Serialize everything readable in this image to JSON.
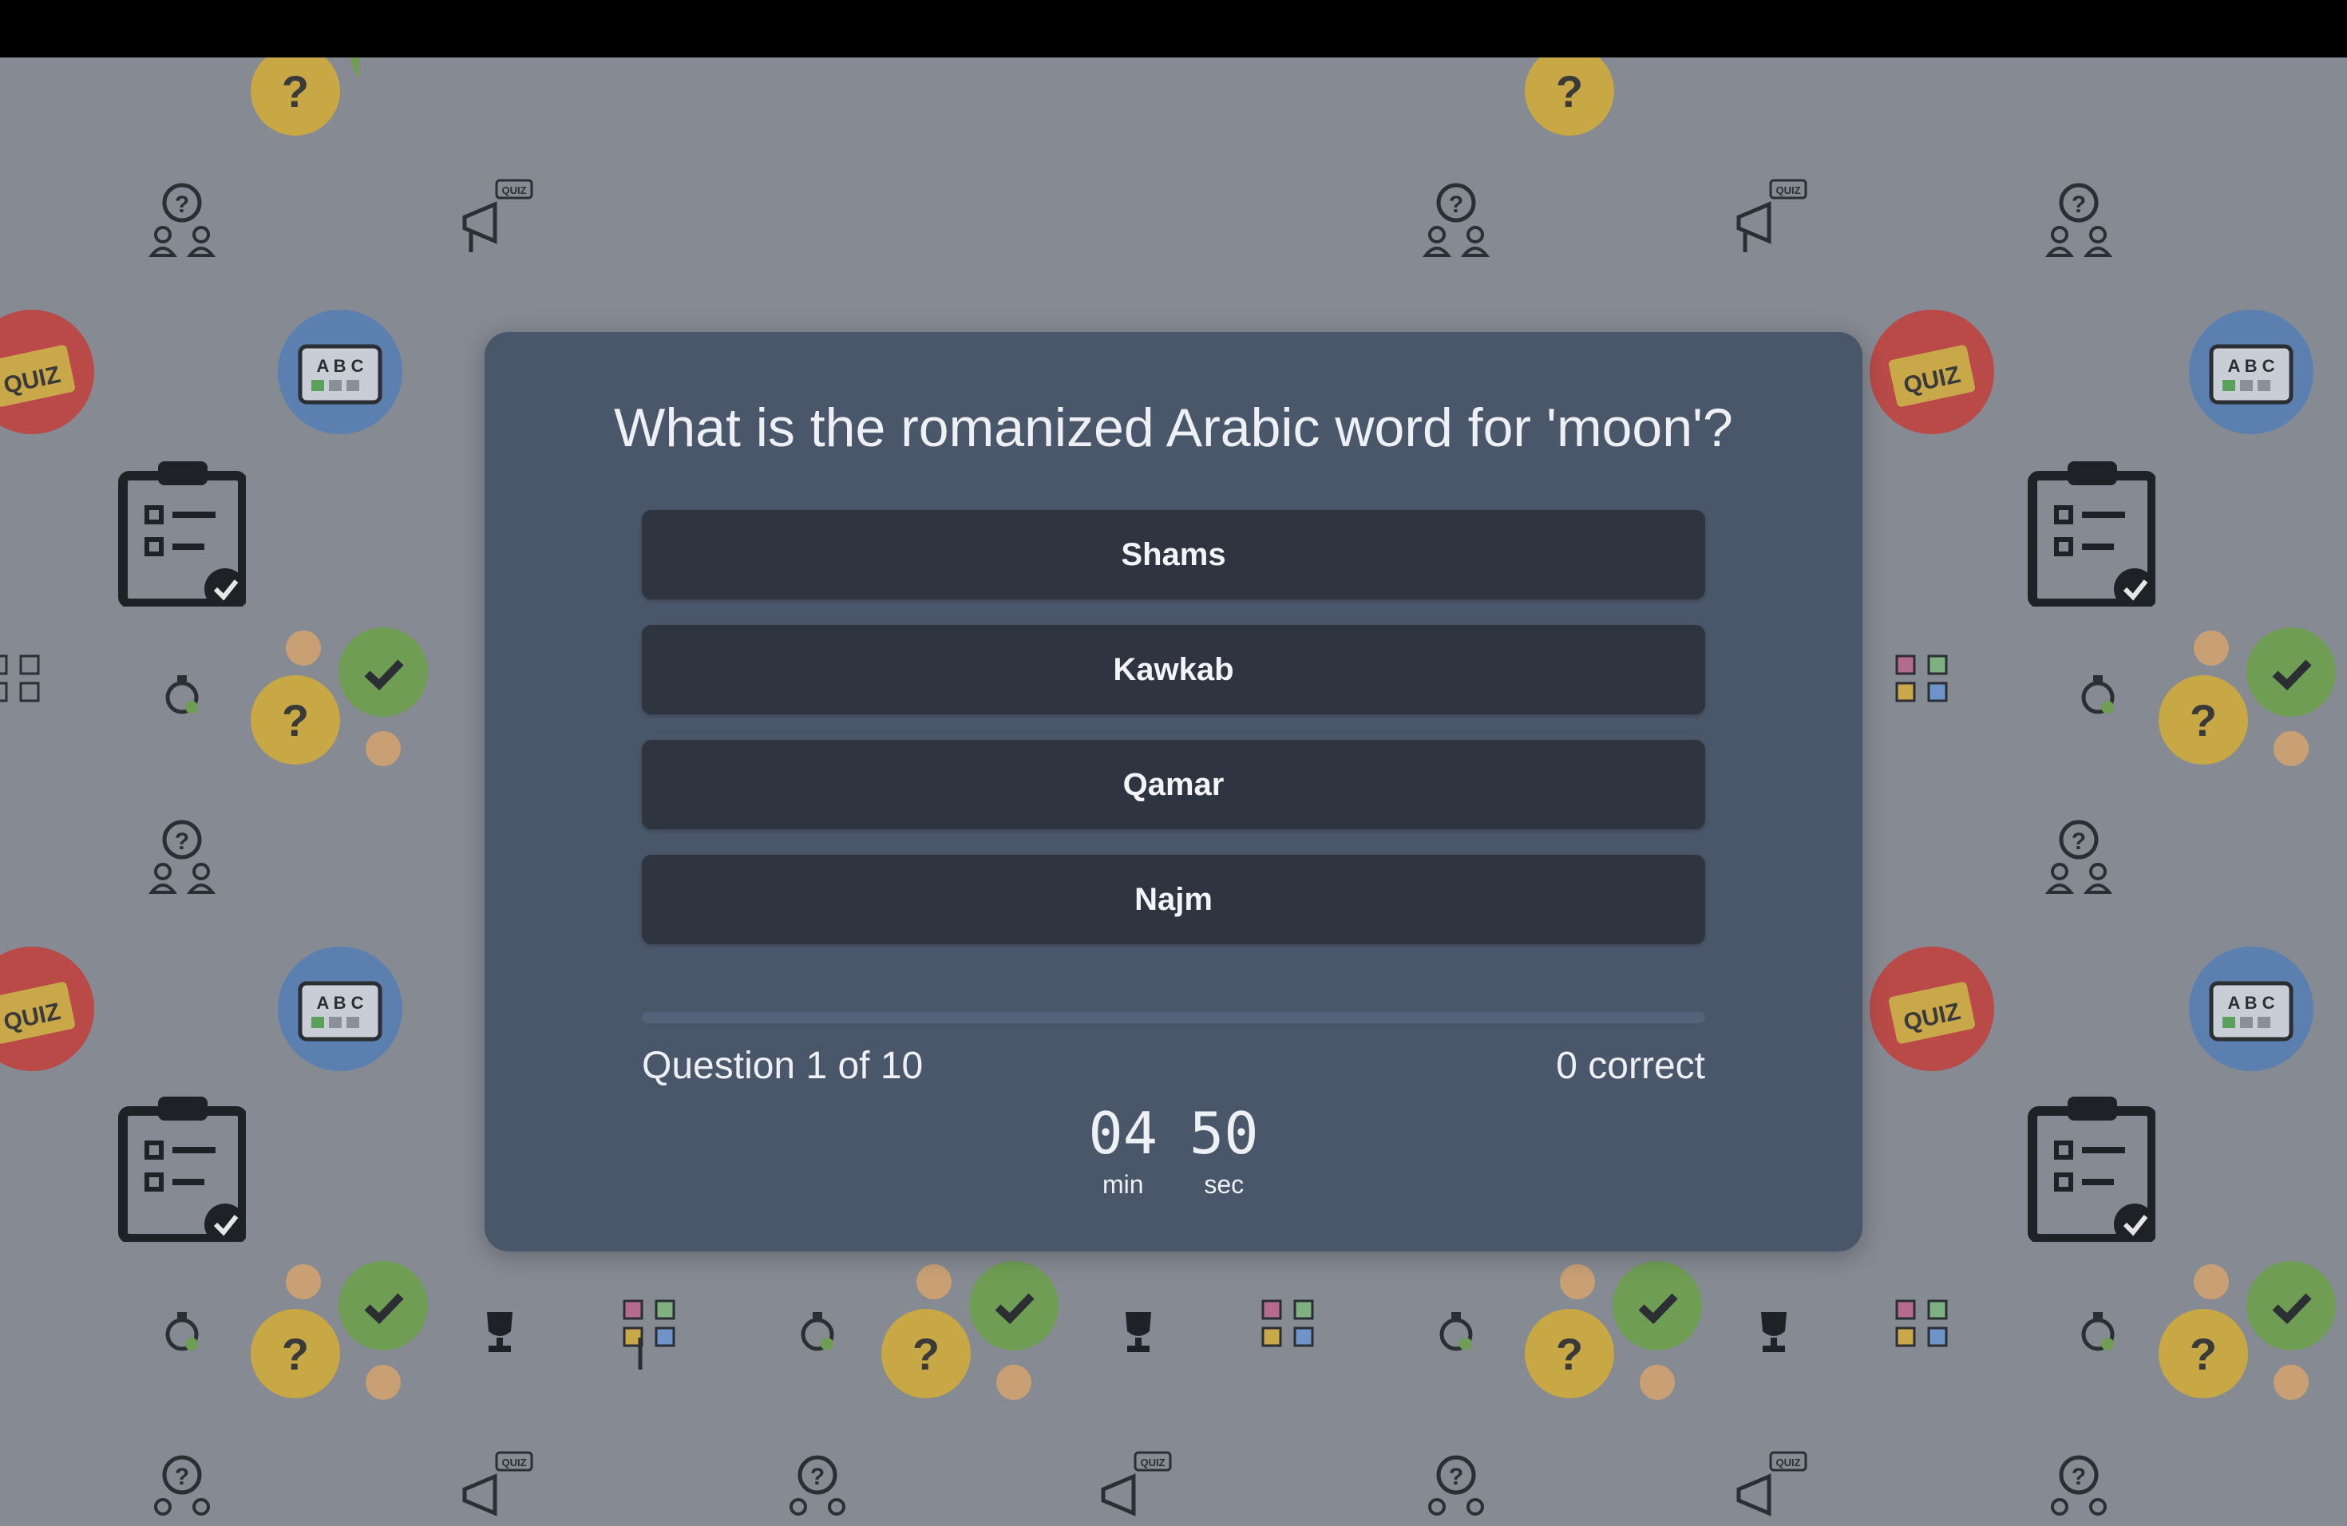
{
  "question": {
    "text": "What is the romanized Arabic word for 'moon'?"
  },
  "answers": [
    {
      "label": "Shams"
    },
    {
      "label": "Kawkab"
    },
    {
      "label": "Qamar"
    },
    {
      "label": "Najm"
    }
  ],
  "progress": {
    "question_status": "Question 1 of 10",
    "correct_status": "0 correct",
    "fraction_complete": 0
  },
  "timer": {
    "minutes": "04",
    "seconds": "50",
    "min_label": "min",
    "sec_label": "sec"
  },
  "background_icons": {
    "badge_quiz_text": "QUIZ",
    "badge_abc_text": "A B C",
    "megaphone_quiz_text": "QUIZ"
  },
  "colors": {
    "card": "#4a5669",
    "button": "#2e3440",
    "page_bg": "#858a93"
  }
}
